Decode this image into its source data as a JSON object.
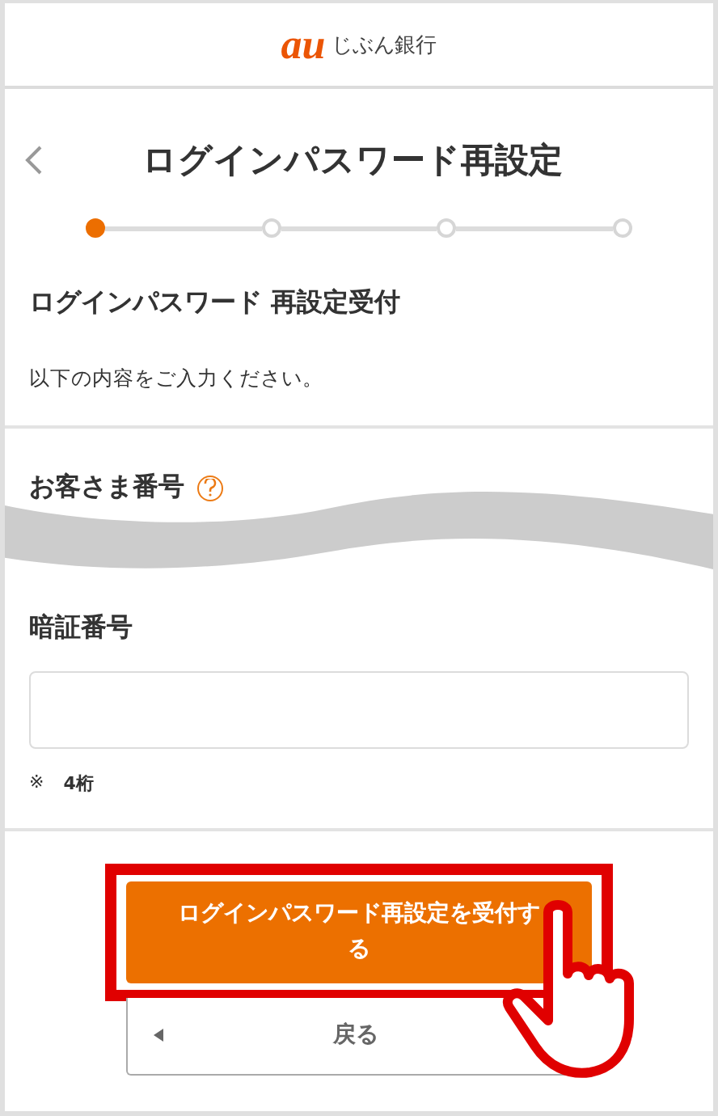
{
  "header": {
    "logo_mark": "au",
    "logo_text": "じぶん銀行"
  },
  "title": "ログインパスワード再設定",
  "steps": [
    {
      "selected": true
    },
    {
      "selected": false
    },
    {
      "selected": false
    },
    {
      "selected": false
    }
  ],
  "section_title": "ログインパスワード 再設定受付",
  "instruction": "以下の内容をご入力ください。",
  "customer_number": {
    "label": "お客さま番号"
  },
  "pin": {
    "label": "暗証番号",
    "note_mark": "※",
    "note": "4桁"
  },
  "submit_button": "ログインパスワード再設定を受付する",
  "back_button": "戻る"
}
